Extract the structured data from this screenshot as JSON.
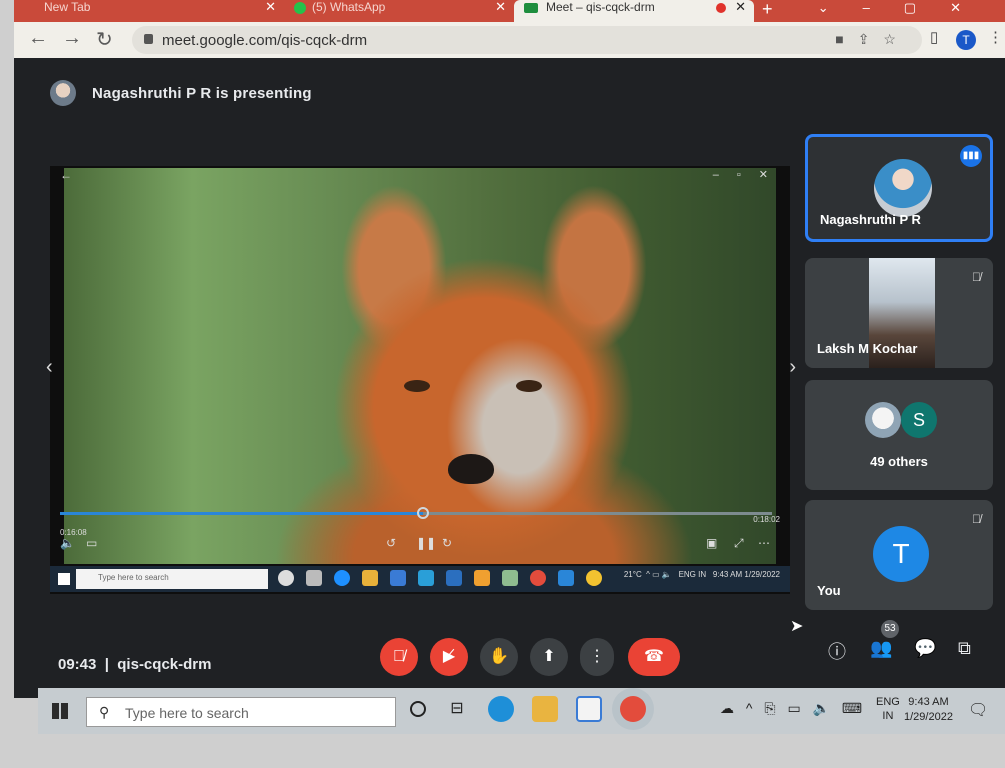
{
  "browser": {
    "tabs": [
      {
        "label": "New Tab"
      },
      {
        "label": "(5) WhatsApp"
      },
      {
        "label": "Meet – qis-cqck-drm"
      }
    ],
    "url": "meet.google.com/qis-cqck-drm",
    "profile_initial": "T"
  },
  "meet": {
    "presenting_banner": "Nagashruthi P R is presenting",
    "participants": [
      {
        "name": "Nagashruthi P R",
        "speaking": true
      },
      {
        "name": "Laksh M Kochar",
        "muted": true
      },
      {
        "name": "49 others",
        "avatar_letter": "S"
      },
      {
        "name": "You",
        "avatar_letter": "T",
        "muted": true
      }
    ],
    "time": "09:43",
    "separator": "|",
    "meeting_code": "qis-cqck-drm",
    "people_count": "53"
  },
  "shared_screen": {
    "elapsed": "0:16:08",
    "remaining": "0:18:02",
    "search_placeholder": "Type here to search",
    "temp": "21°C",
    "lang_top": "ENG",
    "lang_bottom": "IN",
    "clock_time": "9:43 AM",
    "clock_date": "1/29/2022",
    "progress_fraction": 0.51
  },
  "taskbar": {
    "search_placeholder": "Type here to search",
    "lang_top": "ENG",
    "lang_bottom": "IN",
    "clock_time": "9:43 AM",
    "clock_date": "1/29/2022"
  },
  "colors": {
    "accent": "#1a73e8",
    "end_call": "#ea4335",
    "meet_bg": "#1f2124"
  }
}
